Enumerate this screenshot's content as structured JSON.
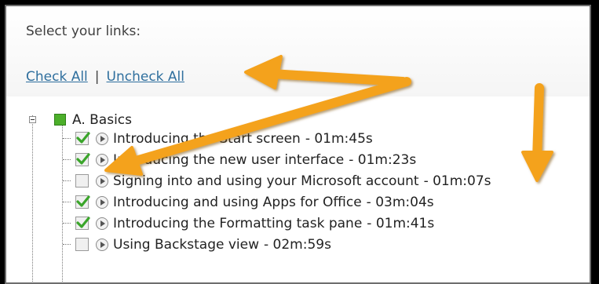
{
  "header": {
    "select_label": "Select your links:",
    "check_all": "Check All",
    "separator": "|",
    "uncheck_all": "Uncheck All"
  },
  "section": {
    "title": "A. Basics"
  },
  "items": [
    {
      "title": "Introducing the Start screen",
      "duration": "- 01m:45s",
      "checked": true
    },
    {
      "title": "Introducing the new user interface",
      "duration": "- 01m:23s",
      "checked": true
    },
    {
      "title": "Signing into and using your Microsoft account",
      "duration": "- 01m:07s",
      "checked": false
    },
    {
      "title": "Introducing and using Apps for Office",
      "duration": "- 03m:04s",
      "checked": true
    },
    {
      "title": "Introducing the Formatting task pane",
      "duration": "- 01m:41s",
      "checked": true
    },
    {
      "title": "Using Backstage view",
      "duration": "- 02m:59s",
      "checked": false
    }
  ],
  "colors": {
    "arrow": "#f4a21d",
    "link": "#2f6f9e",
    "check": "#3aa52a"
  },
  "icons": [
    "tree-collapse-icon",
    "section-green-icon",
    "checkbox-icon",
    "play-icon",
    "arrow-annotation-icon"
  ]
}
